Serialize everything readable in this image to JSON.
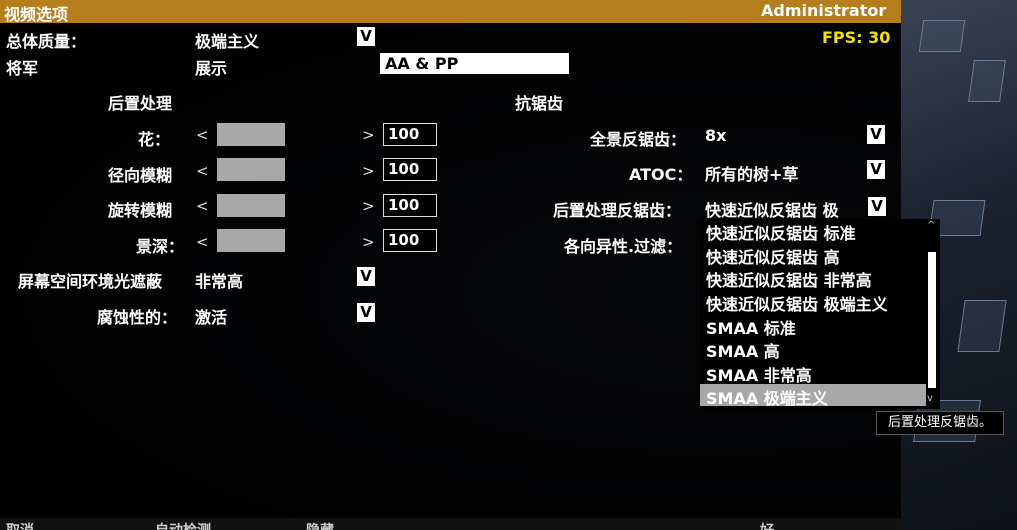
{
  "window": {
    "title": "视频选项",
    "user": "Administrator"
  },
  "header": {
    "quality_label": "总体质量：",
    "quality_value": "极端主义",
    "fps": "FPS: 30"
  },
  "tabs": [
    {
      "label": "将军"
    },
    {
      "label": "展示"
    },
    {
      "label": "AA & PP",
      "active": true
    }
  ],
  "post": {
    "heading": "后置处理",
    "sliders": [
      {
        "label": "花：",
        "value": "100"
      },
      {
        "label": "径向模糊",
        "value": "100"
      },
      {
        "label": "旋转模糊",
        "value": "100"
      },
      {
        "label": "景深：",
        "value": "100"
      }
    ],
    "ssao_label": "屏幕空间环境光遮蔽",
    "ssao_value": "非常高",
    "corrosion_label": "腐蚀性的：",
    "corrosion_value": "激活"
  },
  "aa": {
    "heading": "抗锯齿",
    "fullscreen_label": "全景反锯齿：",
    "fullscreen_value": "8x",
    "atoc_label": "ATOC：",
    "atoc_value": "所有的树+草",
    "ppaa_label": "后置处理反锯齿：",
    "ppaa_value": "快速近似反锯齿 极",
    "aniso_label": "各向异性.过滤："
  },
  "dropdown_options": [
    "快速近似反锯齿 标准",
    "快速近似反锯齿 高",
    "快速近似反锯齿 非常高",
    "快速近似反锯齿 极端主义",
    "SMAA 标准",
    "SMAA 高",
    "SMAA 非常高",
    "SMAA 极端主义"
  ],
  "tooltip": "后置处理反锯齿。",
  "bottom": {
    "b1": "取消",
    "b2": "自动检测",
    "b3": "隐藏",
    "b4": "好"
  },
  "icons": {
    "arrow": "V",
    "left": "<",
    "right": ">",
    "up": "^",
    "down": "v"
  },
  "colors": {
    "titlebar": "#b57d1c",
    "fps": "#f2e200",
    "selected": "#a8a8a8"
  }
}
